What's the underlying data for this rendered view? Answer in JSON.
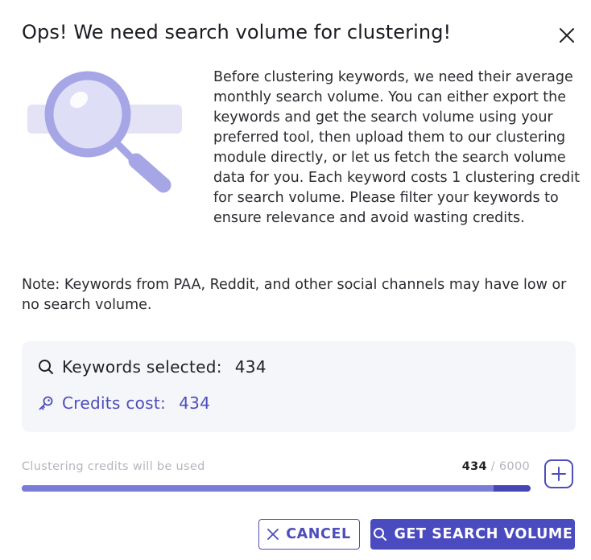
{
  "dialog": {
    "title": "Ops! We need search volume for clustering!",
    "description": "Before clustering keywords, we need their average monthly search volume. You can either export the keywords and get the search volume using your preferred tool, then upload them to our clustering module directly, or let us fetch the search volume data for you. Each keyword costs 1 clustering credit for search volume. Please filter your keywords to ensure relevance and avoid wasting credits.",
    "note": "Note: Keywords from PAA, Reddit, and other social channels may have low or no search volume."
  },
  "summary": {
    "keywords_label": "Keywords selected:",
    "keywords_value": "434",
    "credits_label": "Credits cost:",
    "credits_value": "434"
  },
  "credits": {
    "label": "Clustering credits will be used",
    "used": "434",
    "separator": "/",
    "total": "6000",
    "main_fill_fraction": 0.9276
  },
  "actions": {
    "cancel_label": "CANCEL",
    "get_label": "GET SEARCH VOLUME"
  },
  "icons": {
    "close": "close-icon",
    "illustration": "magnifier-illustration",
    "search": "search-icon",
    "key": "key-icon",
    "plus": "plus-icon",
    "cancel": "x-icon"
  },
  "colors": {
    "accent": "#4b4bc0",
    "accent_light": "#7b7bd8",
    "illustration": "#a8a8e8"
  }
}
